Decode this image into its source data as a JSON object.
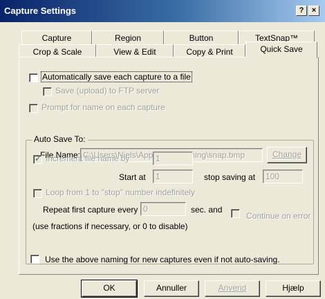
{
  "window": {
    "title": "Capture Settings",
    "help_btn": "?",
    "close_btn": "×"
  },
  "tabs": {
    "row1": [
      "Capture",
      "Region",
      "Button",
      "TextSnap™"
    ],
    "row2": [
      "Crop & Scale",
      "View & Edit",
      "Copy & Print",
      "Quick Save"
    ],
    "active": "Quick Save"
  },
  "options": {
    "auto_save": "Automatically save each capture to a file",
    "ftp_upload": "Save (upload) to FTP server",
    "prompt_name": "Prompt for name on each capture"
  },
  "autosave": {
    "legend": "Auto Save To:",
    "file_name_label": "File Name:",
    "file_name_value": "C:\\Users\\Niels\\AppData\\Roaming\\snap.bmp",
    "change_button": "Change",
    "increment_label": "Increment file name by",
    "increment_value": "1",
    "start_at_label": "Start at",
    "start_at_value": "1",
    "stop_label": "stop saving at",
    "stop_value": "100",
    "loop_label": "Loop from 1 to \"stop\" number indefinitely",
    "repeat_label": "Repeat first capture every",
    "repeat_value": "0",
    "sec_and": "sec. and",
    "continue_label": "Continue on error",
    "hint": "(use fractions if necessary, or 0 to disable)"
  },
  "use_naming": "Use the above naming for new captures even if not auto-saving.",
  "buttons": {
    "ok": "OK",
    "cancel": "Annuller",
    "apply": "Anvend",
    "help": "Hjælp"
  }
}
